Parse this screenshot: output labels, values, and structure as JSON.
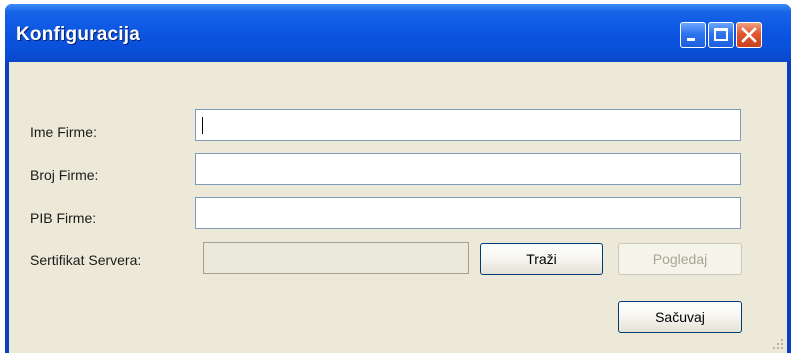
{
  "window": {
    "title": "Konfiguracija",
    "controls": {
      "minimize": "minimize-icon",
      "maximize": "maximize-icon",
      "close": "close-icon"
    }
  },
  "form": {
    "company_name_label": "Ime Firme:",
    "company_name_value": "",
    "company_number_label": "Broj Firme:",
    "company_number_value": "",
    "pib_label": "PIB Firme:",
    "pib_value": "",
    "certificate_label": "Sertifikat Servera:",
    "certificate_value": "",
    "browse_button": "Traži",
    "view_button": "Pogledaj",
    "save_button": "Sačuvaj"
  },
  "colors": {
    "title_bar": "#0a55e2",
    "client_bg": "#ece9d8",
    "close_button": "#e2552e"
  }
}
